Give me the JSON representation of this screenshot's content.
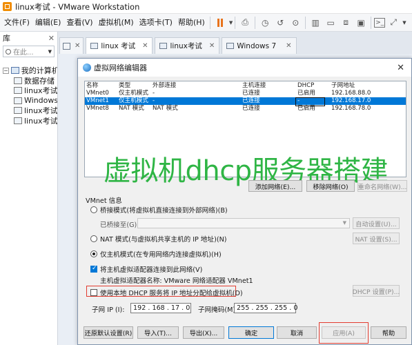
{
  "window": {
    "title": "linux考试 - VMware Workstation"
  },
  "menubar": {
    "items": [
      "文件(F)",
      "编辑(E)",
      "查看(V)",
      "虚拟机(M)",
      "选项卡(T)",
      "帮助(H)"
    ]
  },
  "library": {
    "title": "库",
    "search_placeholder": "在此...",
    "tree": [
      "我的计算机",
      "数据存储",
      "linux考试",
      "Windows",
      "linux考试",
      "linux考试"
    ]
  },
  "tabs": [
    {
      "label": "linux 考试"
    },
    {
      "label": "linux考试"
    },
    {
      "label": "Windows 7"
    }
  ],
  "dialog": {
    "title": "虚拟网络编辑器",
    "columns": [
      "名称",
      "类型",
      "外部连接",
      "主机连接",
      "DHCP",
      "子网地址"
    ],
    "rows": [
      [
        "VMnet0",
        "仅主机模式",
        "-",
        "已连接",
        "已启用",
        "192.168.88.0"
      ],
      [
        "VMnet1",
        "仅主机模式",
        "-",
        "已连接",
        "-",
        "192.168.17.0"
      ],
      [
        "VMnet8",
        "NAT 模式",
        "NAT 模式",
        "已连接",
        "已启用",
        "192.168.78.0"
      ]
    ],
    "watermark": "虚拟机dhcp服务器搭建",
    "buttons": {
      "add_network": "添加网络(E)...",
      "remove_network": "移除网络(O)",
      "rename_network": "重命名网络(W)...",
      "auto_settings": "自动设置(U)...",
      "nat_settings": "NAT 设置(S)...",
      "dhcp_settings": "DHCP 设置(P)...",
      "restore_defaults": "还原默认设置(R)",
      "import": "导入(T)...",
      "export": "导出(X)...",
      "ok": "确定",
      "cancel": "取消",
      "apply": "应用(A)",
      "help": "帮助"
    },
    "vmnet_info": {
      "label": "VMnet 信息",
      "bridged": "桥接模式(将虚拟机直接连接到外部网络)(B)",
      "bridged_to": "已桥接至(G):",
      "nat": "NAT 模式(与虚拟机共享主机的 IP 地址)(N)",
      "host_only": "仅主机模式(在专用网络内连接虚拟机)(H)",
      "connect_adapter": "将主机虚拟适配器连接到此网络(V)",
      "adapter_name_label": "主机虚拟适配器名称: VMware 网络适配器 VMnet1",
      "use_dhcp": "使用本地 DHCP 服务将 IP 地址分配给虚拟机(D)",
      "subnet_ip_label": "子网 IP (I):",
      "subnet_ip": "192 . 168 . 17 . 0",
      "subnet_mask_label": "子网掩码(M):",
      "subnet_mask": "255 . 255 . 255 . 0"
    }
  }
}
